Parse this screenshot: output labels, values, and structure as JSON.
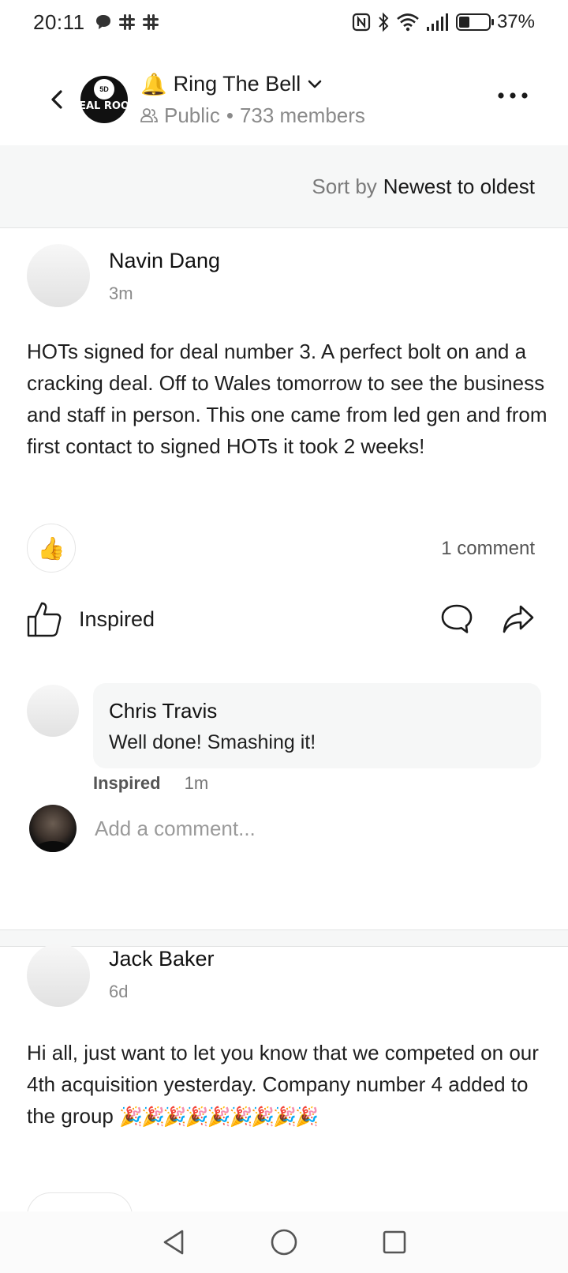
{
  "status_bar": {
    "time": "20:11",
    "battery_percent": "37%",
    "battery_level": 0.37,
    "icons": [
      "chat-bubble-icon",
      "slack-icon",
      "slack-icon",
      "nfc-icon",
      "bluetooth-icon",
      "wifi-icon",
      "signal-icon",
      "battery-icon"
    ]
  },
  "header": {
    "logo_badge": "5D",
    "logo_text": "EAL ROO",
    "group_emoji": "🔔",
    "group_name": "Ring The Bell",
    "visibility": "Public",
    "separator": "•",
    "members": "733 members"
  },
  "sort": {
    "label": "Sort by",
    "value": "Newest to oldest"
  },
  "posts": [
    {
      "author": "Navin Dang",
      "time": "3m",
      "body": "HOTs signed for deal number 3. A perfect bolt on and a cracking deal. Off to Wales tomorrow to see the business and staff in person. This one came from led gen and from first contact to signed HOTs it took 2 weeks!",
      "reaction_emoji": "👍",
      "comment_count": "1 comment",
      "inspired_label": "Inspired",
      "comments": [
        {
          "author": "Chris Travis",
          "text": "Well done! Smashing it!",
          "inspired_label": "Inspired",
          "time": "1m"
        }
      ],
      "add_comment_placeholder": "Add a comment..."
    },
    {
      "author": "Jack Baker",
      "time": "6d",
      "body": "Hi all, just want to let you know that we competed on our 4th acquisition yesterday. Company number 4 added to the group",
      "emojis": "🎉🎉🎉🎉🎉🎉🎉🎉🎉"
    }
  ],
  "nav": {
    "icons": [
      "back-triangle-icon",
      "home-circle-icon",
      "recents-square-icon"
    ]
  }
}
